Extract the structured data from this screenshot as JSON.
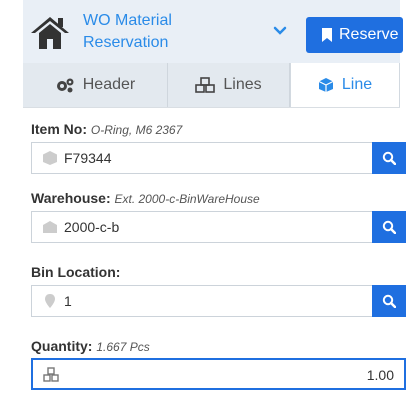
{
  "header": {
    "title_line1": "WO Material",
    "title_line2": "Reservation",
    "reserve_label": "Reserve"
  },
  "tabs": [
    {
      "label": "Header"
    },
    {
      "label": "Lines"
    },
    {
      "label": "Line"
    }
  ],
  "form": {
    "item": {
      "label": "Item No:",
      "detail": "O-Ring, M6 2367",
      "value": "F79344"
    },
    "warehouse": {
      "label": "Warehouse:",
      "detail": "Ext. 2000-c-BinWareHouse",
      "value": "2000-c-b"
    },
    "bin": {
      "label": "Bin Location:",
      "value": "1"
    },
    "quantity": {
      "label": "Quantity:",
      "detail": "1.667 Pcs",
      "value": "1.00"
    }
  },
  "colors": {
    "accent": "#1f6fe0",
    "title": "#2a8be8"
  },
  "icons": [
    "home-icon",
    "chevron-down-icon",
    "bookmark-icon",
    "gears-icon",
    "cubes-icon",
    "cube-icon",
    "search-icon",
    "warehouse-icon",
    "map-marker-icon"
  ]
}
